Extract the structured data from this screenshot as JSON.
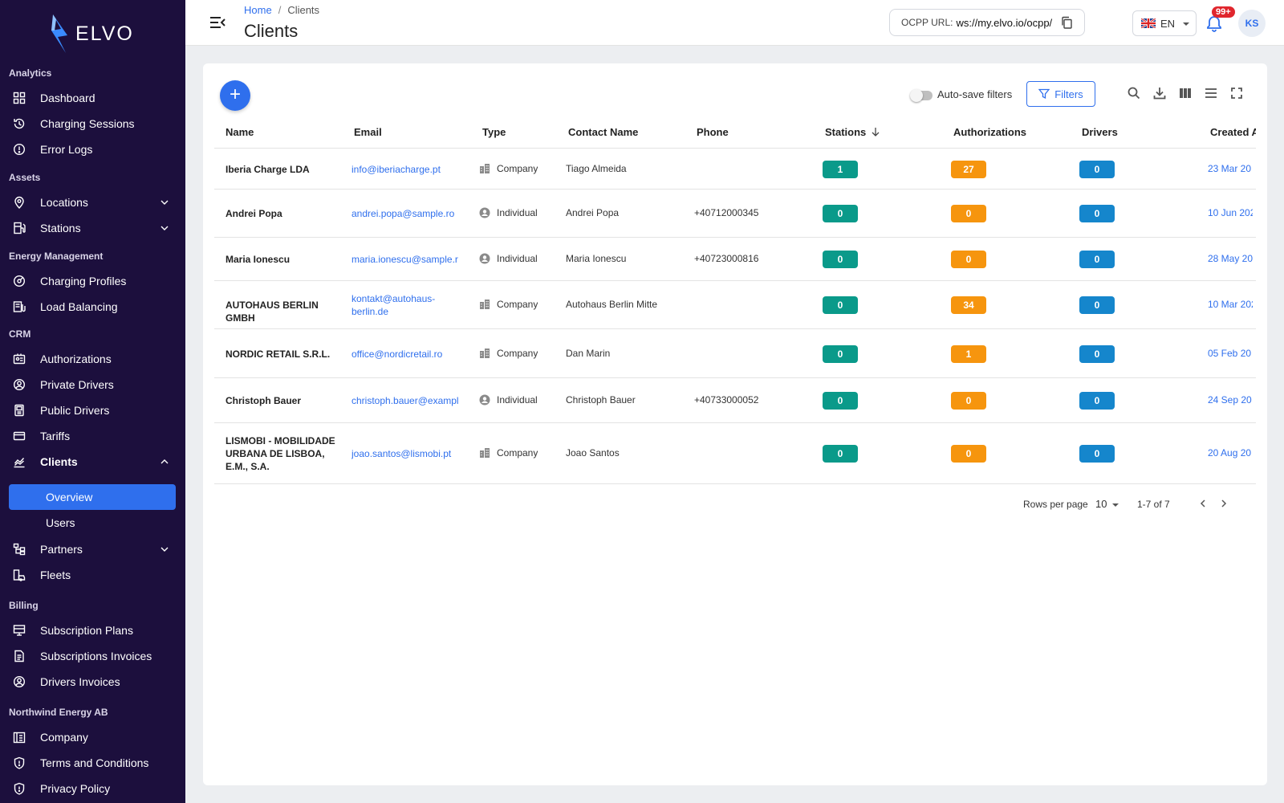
{
  "brand": {
    "name": "ELVO"
  },
  "sidebar": {
    "sections": {
      "analytics": "Analytics",
      "assets": "Assets",
      "energy": "Energy Management",
      "crm": "CRM",
      "billing": "Billing",
      "org": "Northwind Energy AB"
    },
    "items": {
      "dashboard": "Dashboard",
      "charging_sessions": "Charging Sessions",
      "error_logs": "Error Logs",
      "locations": "Locations",
      "stations": "Stations",
      "charging_profiles": "Charging Profiles",
      "load_balancing": "Load Balancing",
      "authorizations": "Authorizations",
      "private_drivers": "Private Drivers",
      "public_drivers": "Public Drivers",
      "tariffs": "Tariffs",
      "clients": "Clients",
      "overview": "Overview",
      "users": "Users",
      "partners": "Partners",
      "fleets": "Fleets",
      "subscription_plans": "Subscription Plans",
      "subscriptions_invoices": "Subscriptions Invoices",
      "drivers_invoices": "Drivers Invoices",
      "company": "Company",
      "terms": "Terms and Conditions",
      "privacy": "Privacy Policy"
    }
  },
  "header": {
    "breadcrumb": {
      "home": "Home",
      "separator": "/",
      "current": "Clients"
    },
    "title": "Clients",
    "ocpp_label": "OCPP URL:",
    "ocpp_url": "ws://my.elvo.io/ocpp/",
    "language": "EN",
    "notifications_badge": "99+",
    "user_initials": "KS"
  },
  "toolbar": {
    "add_label": "+",
    "autosave_label": "Auto-save filters",
    "autosave_on": false,
    "filters_label": "Filters"
  },
  "table": {
    "columns": {
      "name": "Name",
      "email": "Email",
      "type": "Type",
      "contact": "Contact Name",
      "phone": "Phone",
      "stations": "Stations",
      "authorizations": "Authorizations",
      "drivers": "Drivers",
      "created": "Created A"
    },
    "rows": [
      {
        "name": "Iberia Charge LDA",
        "email": "info@iberiacharge.pt",
        "type": "Company",
        "contact": "Tiago Almeida",
        "phone": "",
        "stations": "1",
        "authorizations": "27",
        "drivers": "0",
        "created": "23 Mar 20"
      },
      {
        "name": "Andrei Popa",
        "email": "andrei.popa@sample.ro",
        "type": "Individual",
        "contact": "Andrei Popa",
        "phone": "+40712000345",
        "stations": "0",
        "authorizations": "0",
        "drivers": "0",
        "created": "10 Jun 202"
      },
      {
        "name": "Maria Ionescu",
        "email": "maria.ionescu@sample.r",
        "type": "Individual",
        "contact": "Maria Ionescu",
        "phone": "+40723000816",
        "stations": "0",
        "authorizations": "0",
        "drivers": "0",
        "created": "28 May 20"
      },
      {
        "name": "AUTOHAUS BERLIN GMBH",
        "email": "kontakt@autohaus-berlin.de",
        "type": "Company",
        "contact": "Autohaus Berlin Mitte",
        "phone": "",
        "stations": "0",
        "authorizations": "34",
        "drivers": "0",
        "created": "10 Mar 202"
      },
      {
        "name": "NORDIC RETAIL S.R.L.",
        "email": "office@nordicretail.ro",
        "type": "Company",
        "contact": "Dan Marin",
        "phone": "",
        "stations": "0",
        "authorizations": "1",
        "drivers": "0",
        "created": "05 Feb 20"
      },
      {
        "name": "Christoph Bauer",
        "email": "christoph.bauer@exampl",
        "type": "Individual",
        "contact": "Christoph Bauer",
        "phone": "+40733000052",
        "stations": "0",
        "authorizations": "0",
        "drivers": "0",
        "created": "24 Sep 20"
      },
      {
        "name": "LISMOBI - MOBILIDADE URBANA DE LISBOA, E.M., S.A.",
        "email": "joao.santos@lismobi.pt",
        "type": "Company",
        "contact": "Joao Santos",
        "phone": "",
        "stations": "0",
        "authorizations": "0",
        "drivers": "0",
        "created": "20 Aug 20"
      }
    ]
  },
  "pagination": {
    "rows_per_page_label": "Rows per page",
    "rows_per_page": "10",
    "range": "1-7 of 7"
  },
  "colors": {
    "sidebar_bg": "#1c0f3d",
    "accent": "#2f6fed",
    "stations_badge": "#0a9a8a",
    "authorizations_badge": "#f6950e",
    "drivers_badge": "#1586cc"
  }
}
